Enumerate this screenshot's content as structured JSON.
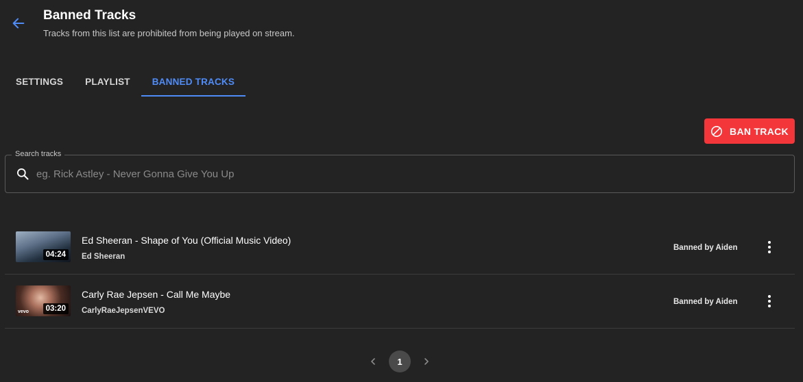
{
  "header": {
    "back_icon": "arrow-left-icon",
    "title": "Banned Tracks",
    "subtitle": "Tracks from this list are prohibited from being played on stream."
  },
  "tabs": [
    {
      "label": "SETTINGS",
      "active": false
    },
    {
      "label": "PLAYLIST",
      "active": false
    },
    {
      "label": "BANNED TRACKS",
      "active": true
    }
  ],
  "ban_button": {
    "label": "BAN TRACK",
    "icon": "block-icon",
    "color": "#f2363a"
  },
  "search": {
    "legend": "Search tracks",
    "placeholder": "eg. Rick Astley - Never Gonna Give You Up",
    "value": ""
  },
  "tracks": [
    {
      "title": "Ed Sheeran - Shape of You (Official Music Video)",
      "channel": "Ed Sheeran",
      "duration": "04:24",
      "banned_by": "Banned by Aiden"
    },
    {
      "title": "Carly Rae Jepsen - Call Me Maybe",
      "channel": "CarlyRaeJepsenVEVO",
      "duration": "03:20",
      "thumb_logo": "vevo",
      "banned_by": "Banned by Aiden"
    }
  ],
  "pagination": {
    "current_page": "1"
  },
  "colors": {
    "accent": "#4f8cf7",
    "danger": "#f2363a",
    "background": "#232323"
  }
}
